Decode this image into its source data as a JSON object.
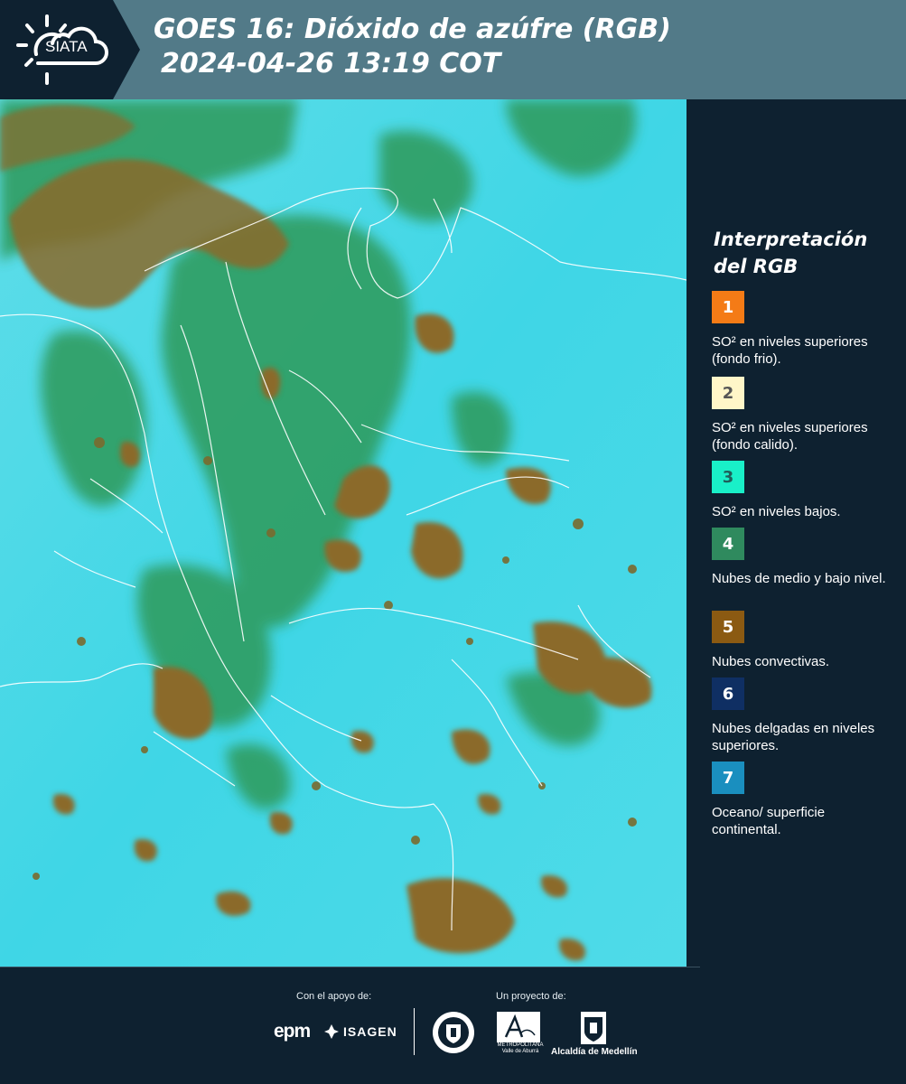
{
  "header": {
    "logo_text": "SIATA",
    "title_line1": "GOES 16: Dióxido de azúfre (RGB)",
    "title_line2": "2024-04-26 13:19 COT"
  },
  "map": {
    "colors": {
      "land_surface": "#38d8e6",
      "low_mid_cloud": "#2f9a5a",
      "convective_cloud": "#8b6a2a",
      "border_line": "#ffffff"
    }
  },
  "legend": {
    "title": "Interpretación del RGB",
    "items": [
      {
        "number": "1",
        "color": "#f47b16",
        "text_color": "#ffffff",
        "text": "SO² en niveles superiores (fondo frio)."
      },
      {
        "number": "2",
        "color": "#fff6c8",
        "text_color": "#555555",
        "text": "SO² en niveles superiores (fondo calido)."
      },
      {
        "number": "3",
        "color": "#19f0c8",
        "text_color": "#1f5f5a",
        "text": "SO² en niveles bajos."
      },
      {
        "number": "4",
        "color": "#2f8a5e",
        "text_color": "#ffffff",
        "text": "Nubes de medio y bajo nivel."
      },
      {
        "number": "5",
        "color": "#8b5a12",
        "text_color": "#ffffff",
        "text": "Nubes convectivas."
      },
      {
        "number": "6",
        "color": "#0f2f63",
        "text_color": "#ffffff",
        "text": "Nubes delgadas en niveles superiores."
      },
      {
        "number": "7",
        "color": "#1a8fbf",
        "text_color": "#ffffff",
        "text": "Oceano/ superficie continental."
      }
    ]
  },
  "footer": {
    "support_label": "Con el apoyo de:",
    "project_label": "Un proyecto de:",
    "epm": "epm",
    "isagen": "ISAGEN",
    "area_name": "Área",
    "area_sub": "METROPOLITANA Valle de Aburrá",
    "alcaldia": "Alcaldía de Medellín"
  }
}
